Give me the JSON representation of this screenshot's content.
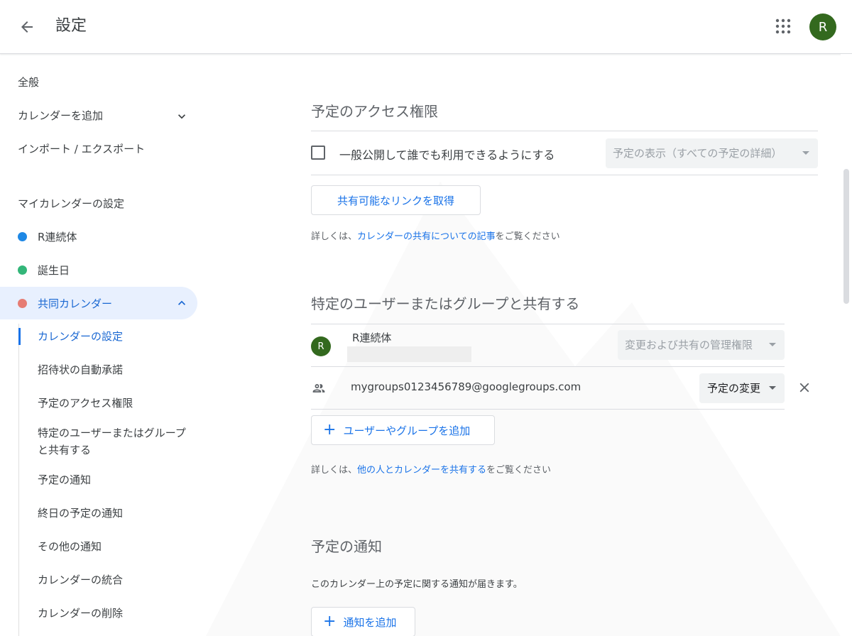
{
  "header": {
    "title": "設定",
    "avatar_letter": "R"
  },
  "sidebar": {
    "general": "全般",
    "add_calendar": "カレンダーを追加",
    "import_export": "インポート / エクスポート",
    "my_calendars_heading": "マイカレンダーの設定",
    "calendars": [
      {
        "label": "R連続体",
        "color": "#1e88e5"
      },
      {
        "label": "誕生日",
        "color": "#33b679"
      },
      {
        "label": "共同カレンダー",
        "color": "#e67c73"
      }
    ],
    "sub_items": [
      "カレンダーの設定",
      "招待状の自動承諾",
      "予定のアクセス権限",
      "特定のユーザーまたはグループと共有する",
      "予定の通知",
      "終日の予定の通知",
      "その他の通知",
      "カレンダーの統合",
      "カレンダーの削除"
    ]
  },
  "access": {
    "title": "予定のアクセス権限",
    "public_checkbox_label": "一般公開して誰でも利用できるようにする",
    "public_checked": false,
    "visibility_select": "予定の表示（すべての予定の詳細）",
    "share_link_button": "共有可能なリンクを取得",
    "help_prefix": "詳しくは、",
    "help_link": "カレンダーの共有についての記事",
    "help_suffix": "をご覧ください"
  },
  "sharing": {
    "title": "特定のユーザーまたはグループと共有する",
    "owner": {
      "avatar_letter": "R",
      "name": "R連続体",
      "permission": "変更および共有の管理権限"
    },
    "members": [
      {
        "email": "mygroups0123456789@googlegroups.com",
        "permission": "予定の変更"
      }
    ],
    "add_button": "ユーザーやグループを追加",
    "help_prefix": "詳しくは、",
    "help_link": "他の人とカレンダーを共有する",
    "help_suffix": "をご覧ください"
  },
  "notifications": {
    "title": "予定の通知",
    "description": "このカレンダー上の予定に関する通知が届きます。",
    "add_button": "通知を追加"
  },
  "icons": {
    "back": "arrow-back-icon",
    "apps": "apps-grid-icon",
    "chevron_down": "chevron-down-icon",
    "chevron_up": "chevron-up-icon",
    "group": "group-icon",
    "close": "close-icon",
    "plus": "plus-icon"
  },
  "colors": {
    "accent": "#1a73e8",
    "active_bg": "#e8f0fe",
    "avatar": "#33691e"
  }
}
